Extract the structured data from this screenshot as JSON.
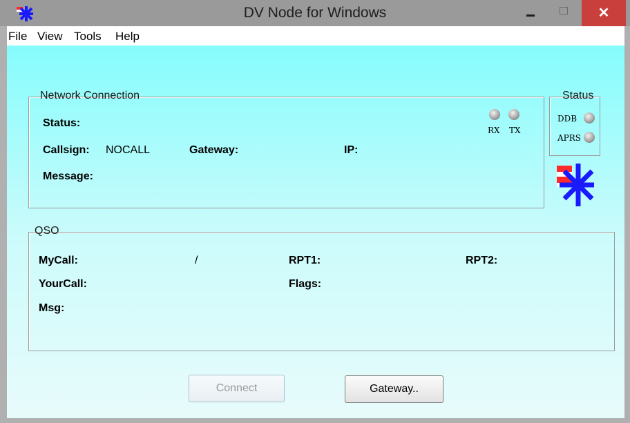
{
  "window": {
    "title": "DV Node for Windows",
    "close_glyph": "✕"
  },
  "menu": [
    "File",
    "View",
    "Tools",
    "Help"
  ],
  "network": {
    "group_title": "Network Connection",
    "status_label": "Status:",
    "callsign_label": "Callsign:",
    "callsign_value": "NOCALL",
    "gateway_label": "Gateway:",
    "ip_label": "IP:",
    "message_label": "Message:",
    "rx_label": "RX",
    "tx_label": "TX"
  },
  "status_box": {
    "group_title": "Status",
    "ddb_label": "DDB",
    "aprs_label": "APRS"
  },
  "qso": {
    "group_title": "QSO",
    "mycall_label": "MyCall:",
    "mycall_separator": "/",
    "rpt1_label": "RPT1:",
    "rpt2_label": "RPT2:",
    "yourcall_label": "YourCall:",
    "flags_label": "Flags:",
    "msg_label": "Msg:"
  },
  "buttons": {
    "connect": "Connect",
    "gateway": "Gateway.."
  },
  "colors": {
    "background_top": "#7ffcfd",
    "logo_blue": "#1a1aff",
    "logo_red": "#ff2a2a",
    "close_red": "#c93f3c"
  },
  "icons": [
    "app-logo-icon",
    "minimize-icon",
    "maximize-icon",
    "close-icon",
    "rx-led-icon",
    "tx-led-icon",
    "ddb-led-icon",
    "aprs-led-icon",
    "dv-logo-icon"
  ]
}
